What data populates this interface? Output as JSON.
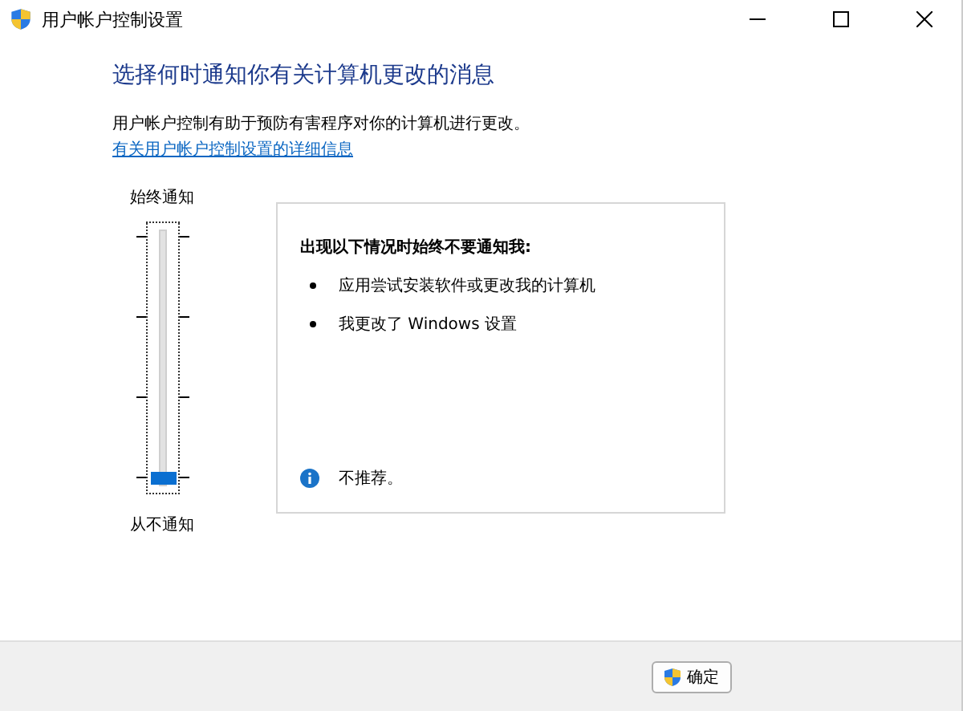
{
  "window": {
    "title": "用户帐户控制设置"
  },
  "heading": "选择何时通知你有关计算机更改的消息",
  "description": "用户帐户控制有助于预防有害程序对你的计算机进行更改。",
  "link": "有关用户帐户控制设置的详细信息",
  "slider": {
    "top_label": "始终通知",
    "bottom_label": "从不通知",
    "level": 0
  },
  "panel": {
    "title": "出现以下情况时始终不要通知我:",
    "items": [
      "应用尝试安装软件或更改我的计算机",
      "我更改了 Windows 设置"
    ],
    "note": "不推荐。"
  },
  "buttons": [
    {
      "label": "确定"
    }
  ]
}
